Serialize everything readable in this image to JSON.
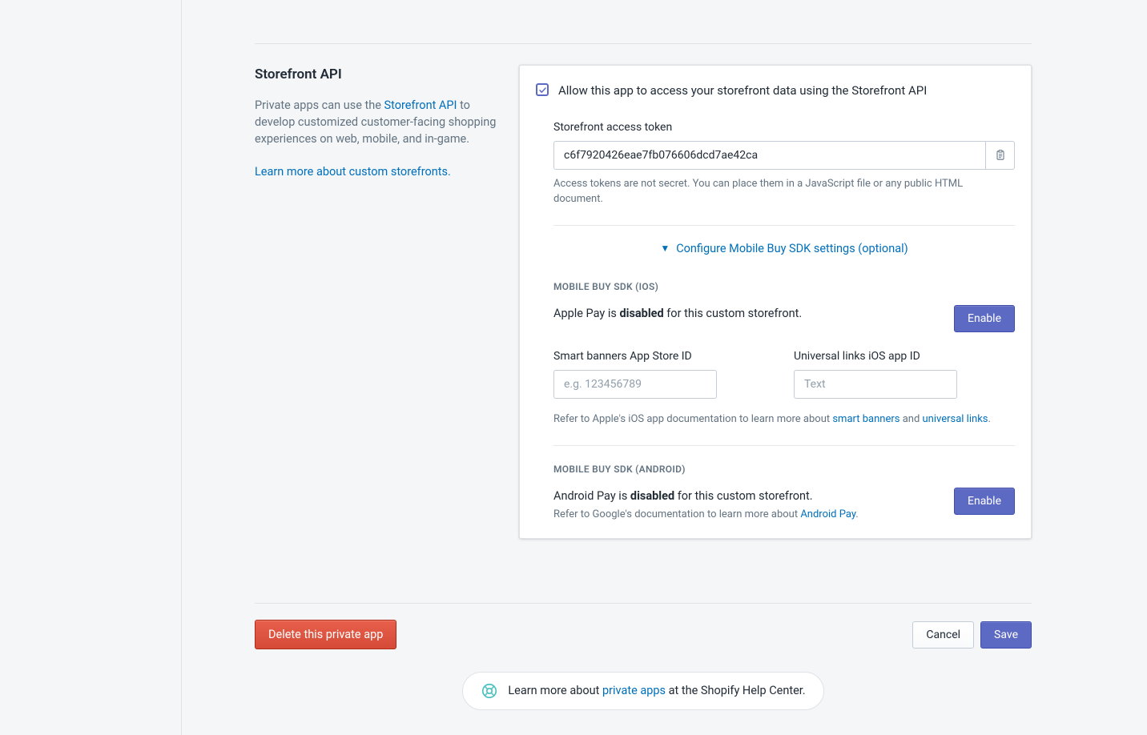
{
  "left": {
    "title": "Storefront API",
    "desc_pre": "Private apps can use the ",
    "desc_link": "Storefront API",
    "desc_post": " to develop customized customer-facing shopping experiences on web, mobile, and in-game.",
    "learn_more": "Learn more about custom storefronts."
  },
  "card": {
    "checkbox_label": "Allow this app to access your storefront data using the Storefront API",
    "token_label": "Storefront access token",
    "token_value": "c6f7920426eae7fb076606dcd7ae42ca",
    "token_help": "Access tokens are not secret. You can place them in a JavaScript file or any public HTML document.",
    "expand_label": "Configure Mobile Buy SDK settings (optional)",
    "expand_caret": "▼",
    "ios": {
      "heading": "MOBILE BUY SDK (IOS)",
      "status_pre": "Apple Pay is ",
      "status_strong": "disabled",
      "status_post": " for this custom storefront.",
      "enable_label": "Enable",
      "field1_label": "Smart banners App Store ID",
      "field1_placeholder": "e.g. 123456789",
      "field2_label": "Universal links iOS app ID",
      "field2_placeholder": "Text",
      "doc_pre": "Refer to Apple's iOS app documentation to learn more about ",
      "doc_link1": "smart banners",
      "doc_mid": " and ",
      "doc_link2": "universal links",
      "doc_post": "."
    },
    "android": {
      "heading": "MOBILE BUY SDK (ANDROID)",
      "status_pre": "Android Pay is ",
      "status_strong": "disabled",
      "status_post": " for this custom storefront.",
      "doc_pre": "Refer to Google's documentation to learn more about ",
      "doc_link": "Android Pay",
      "doc_post": ".",
      "enable_label": "Enable"
    }
  },
  "footer": {
    "delete_label": "Delete this private app",
    "cancel_label": "Cancel",
    "save_label": "Save"
  },
  "help": {
    "pre": "Learn more about ",
    "link": "private apps",
    "post": " at the Shopify Help Center."
  }
}
